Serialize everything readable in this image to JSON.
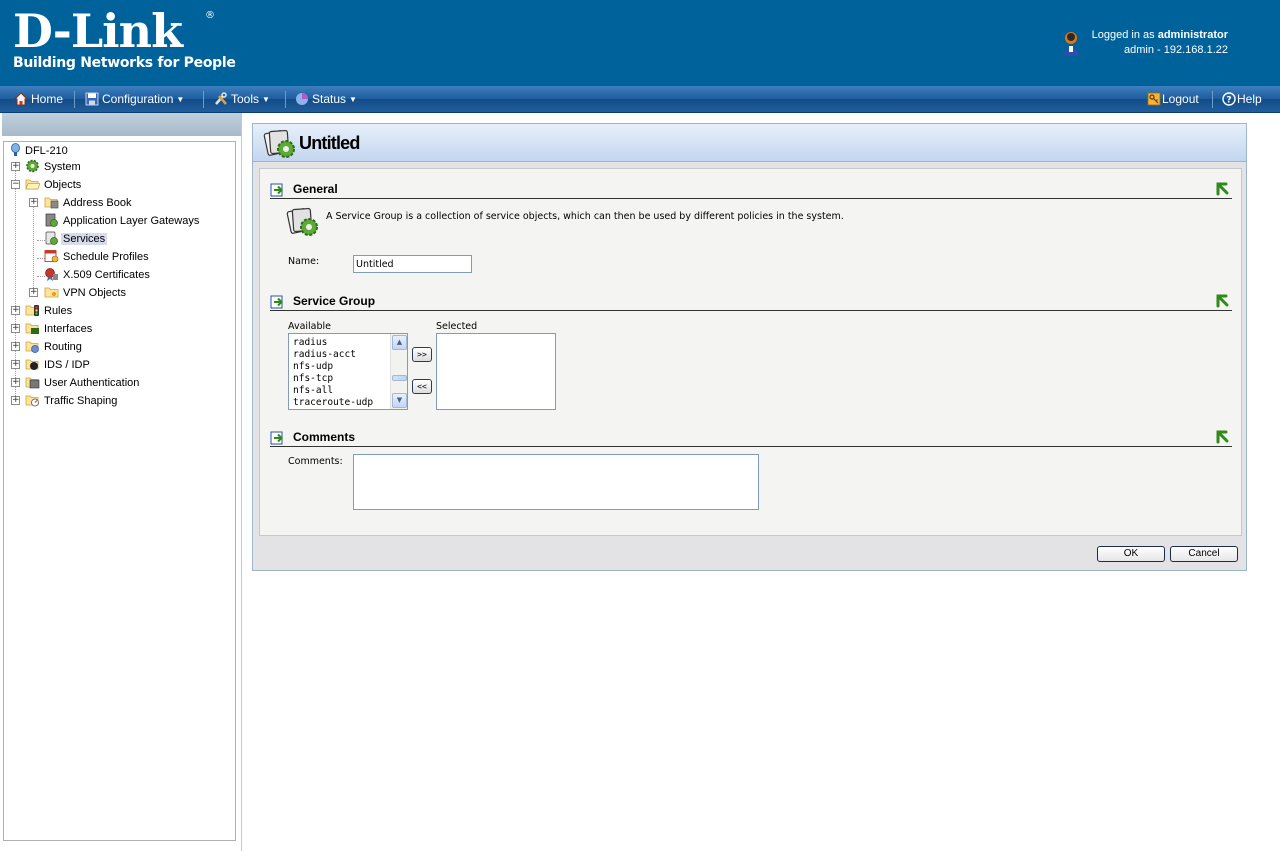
{
  "header": {
    "logo_main": "D-Link",
    "logo_reg": "®",
    "logo_tagline": "Building Networks for People",
    "logged_in_prefix": "Logged in as ",
    "logged_in_user": "administrator",
    "session": "admin - 192.168.1.22"
  },
  "menu": {
    "home": "Home",
    "configuration": "Configuration",
    "tools": "Tools",
    "status": "Status",
    "logout": "Logout",
    "help": "Help"
  },
  "tree": {
    "root": "DFL-210",
    "system": "System",
    "objects": "Objects",
    "address_book": "Address Book",
    "alg": "Application Layer Gateways",
    "services": "Services",
    "schedule_profiles": "Schedule Profiles",
    "certificates": "X.509 Certificates",
    "vpn_objects": "VPN Objects",
    "rules": "Rules",
    "interfaces": "Interfaces",
    "routing": "Routing",
    "ids_idp": "IDS / IDP",
    "user_auth": "User Authentication",
    "traffic_shaping": "Traffic Shaping"
  },
  "dialog": {
    "title": "Untitled",
    "general": {
      "heading": "General",
      "description": "A Service Group is a collection of service objects, which can then be used by different policies in the system.",
      "name_label": "Name:",
      "name_value": "Untitled"
    },
    "service_group": {
      "heading": "Service Group",
      "available_label": "Available",
      "selected_label": "Selected",
      "available_items": [
        "radius",
        "radius-acct",
        "nfs-udp",
        "nfs-tcp",
        "nfs-all",
        "traceroute-udp"
      ],
      "add_button": ">>",
      "remove_button": "<<"
    },
    "comments": {
      "heading": "Comments",
      "label": "Comments:",
      "value": ""
    },
    "ok": "OK",
    "cancel": "Cancel"
  },
  "colors": {
    "header_bg": "#00629a",
    "menubar": "#1e5c9c",
    "tree_selected": "#d7dcec"
  }
}
